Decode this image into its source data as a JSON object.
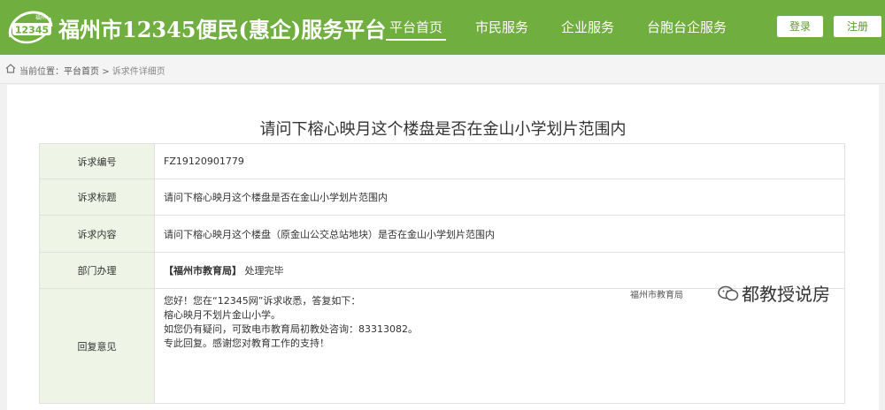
{
  "header": {
    "logo_text": "12345",
    "logo_subtext": "福州",
    "site_title": "福州市12345便民(惠企)服务平台",
    "nav": [
      "平台首页",
      "市民服务",
      "企业服务",
      "台胞台企服务"
    ],
    "login": "登录",
    "register": "注册"
  },
  "breadcrumb": {
    "prefix": "当前位置：",
    "home": "平台首页",
    "separator": ">",
    "current": "诉求件详细页"
  },
  "page": {
    "title": "请问下榕心映月这个楼盘是否在金山小学划片范围内"
  },
  "detail": {
    "rows": [
      {
        "label": "诉求编号",
        "value": "FZ19120901779"
      },
      {
        "label": "诉求标题",
        "value": "请问下榕心映月这个楼盘是否在金山小学划片范围内"
      },
      {
        "label": "诉求内容",
        "value": "请问下榕心映月这个楼盘（原金山公交总站地块）是否在金山小学划片范围内"
      }
    ],
    "dept_label": "部门办理",
    "dept_name": "【福州市教育局】",
    "dept_status": "处理完毕",
    "reply_label": "回复意见",
    "reply_lines": [
      "您好！您在“12345网”诉求收悉，答复如下：",
      "榕心映月不划片金山小学。",
      "如您仍有疑问，可致电市教育局初教处咨询：83313082。",
      "专此回复。感谢您对教育工作的支持！"
    ]
  },
  "watermark": {
    "org": "福州市教育局",
    "brand": "都教授说房"
  },
  "colors": {
    "header_green": "#6fae3f",
    "label_bg": "#eff5e6",
    "label_text": "#6b9b3d"
  }
}
